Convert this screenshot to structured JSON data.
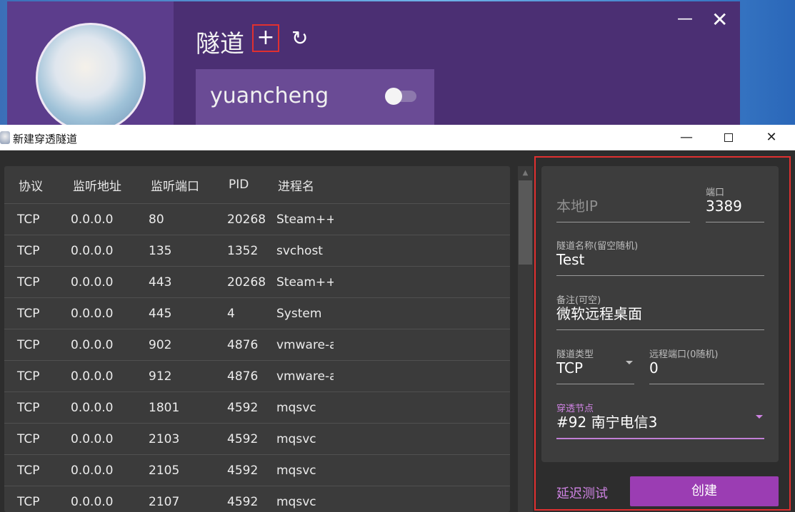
{
  "background_window": {
    "title": "隧道",
    "add_icon": "plus-icon",
    "refresh_icon": "refresh-icon",
    "tunnel_card_name": "yuancheng"
  },
  "dialog": {
    "title": "新建穿透隧道",
    "table": {
      "headers": [
        "协议",
        "监听地址",
        "监听端口",
        "PID",
        "进程名"
      ],
      "rows": [
        [
          "TCP",
          "0.0.0.0",
          "80",
          "20268",
          "Steam++"
        ],
        [
          "TCP",
          "0.0.0.0",
          "135",
          "1352",
          "svchost"
        ],
        [
          "TCP",
          "0.0.0.0",
          "443",
          "20268",
          "Steam++"
        ],
        [
          "TCP",
          "0.0.0.0",
          "445",
          "4",
          "System"
        ],
        [
          "TCP",
          "0.0.0.0",
          "902",
          "4876",
          "vmware-a"
        ],
        [
          "TCP",
          "0.0.0.0",
          "912",
          "4876",
          "vmware-a"
        ],
        [
          "TCP",
          "0.0.0.0",
          "1801",
          "4592",
          "mqsvc"
        ],
        [
          "TCP",
          "0.0.0.0",
          "2103",
          "4592",
          "mqsvc"
        ],
        [
          "TCP",
          "0.0.0.0",
          "2105",
          "4592",
          "mqsvc"
        ],
        [
          "TCP",
          "0.0.0.0",
          "2107",
          "4592",
          "mqsvc"
        ]
      ]
    },
    "form": {
      "local_ip": {
        "placeholder": "本地IP",
        "value": ""
      },
      "port": {
        "label": "端口",
        "value": "3389"
      },
      "tunnel_name": {
        "label": "隧道名称(留空随机)",
        "value": "Test"
      },
      "note": {
        "label": "备注(可空)",
        "value": "微软远程桌面"
      },
      "tunnel_type": {
        "label": "隧道类型",
        "value": "TCP"
      },
      "remote_port": {
        "label": "远程端口(0随机)",
        "value": "0"
      },
      "node": {
        "label": "穿透节点",
        "value": "#92 南宁电信3"
      }
    },
    "buttons": {
      "latency_test": "延迟测试",
      "create": "创建"
    }
  },
  "colors": {
    "accent": "#9b3db3",
    "accent_text": "#cf83e3",
    "highlight": "#e03030"
  }
}
